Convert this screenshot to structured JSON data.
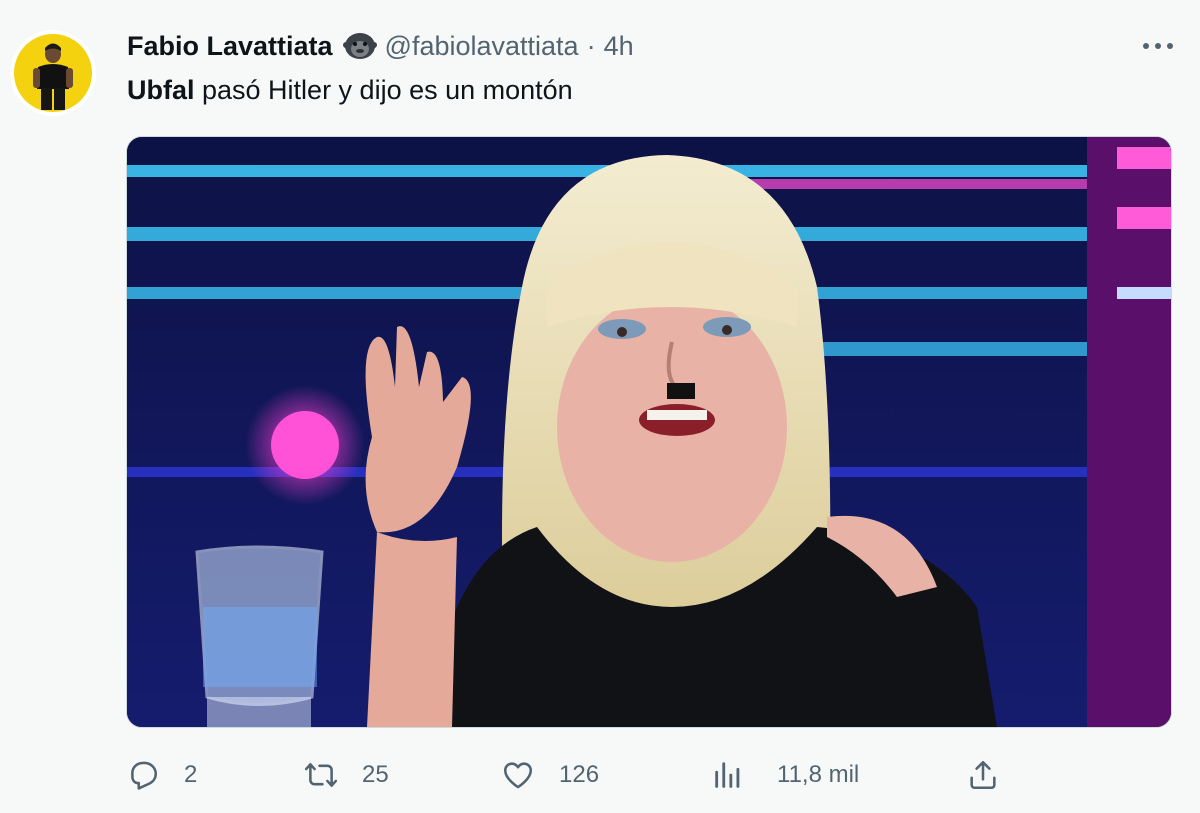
{
  "tweet": {
    "author": {
      "display_name": "Fabio Lavattiata",
      "badge_icon": "gorilla-emoji-icon",
      "handle": "@fabiolavattiata",
      "separator": "·",
      "time": "4h"
    },
    "text": {
      "mention": "Ubfal",
      "rest": " pasó Hitler y dijo es un montón"
    },
    "media": {
      "kind": "photo",
      "icon": "photo-image"
    },
    "actions": {
      "reply": {
        "icon": "reply-icon",
        "count": "2"
      },
      "retweet": {
        "icon": "retweet-icon",
        "count": "25"
      },
      "like": {
        "icon": "heart-icon",
        "count": "126"
      },
      "views": {
        "icon": "views-icon",
        "count": "11,8 mil"
      },
      "share": {
        "icon": "share-icon"
      }
    }
  },
  "colors": {
    "background": "#f7f9f9",
    "text_primary": "#0f1419",
    "text_secondary": "#536471",
    "avatar_bg": "#f4d20f"
  }
}
